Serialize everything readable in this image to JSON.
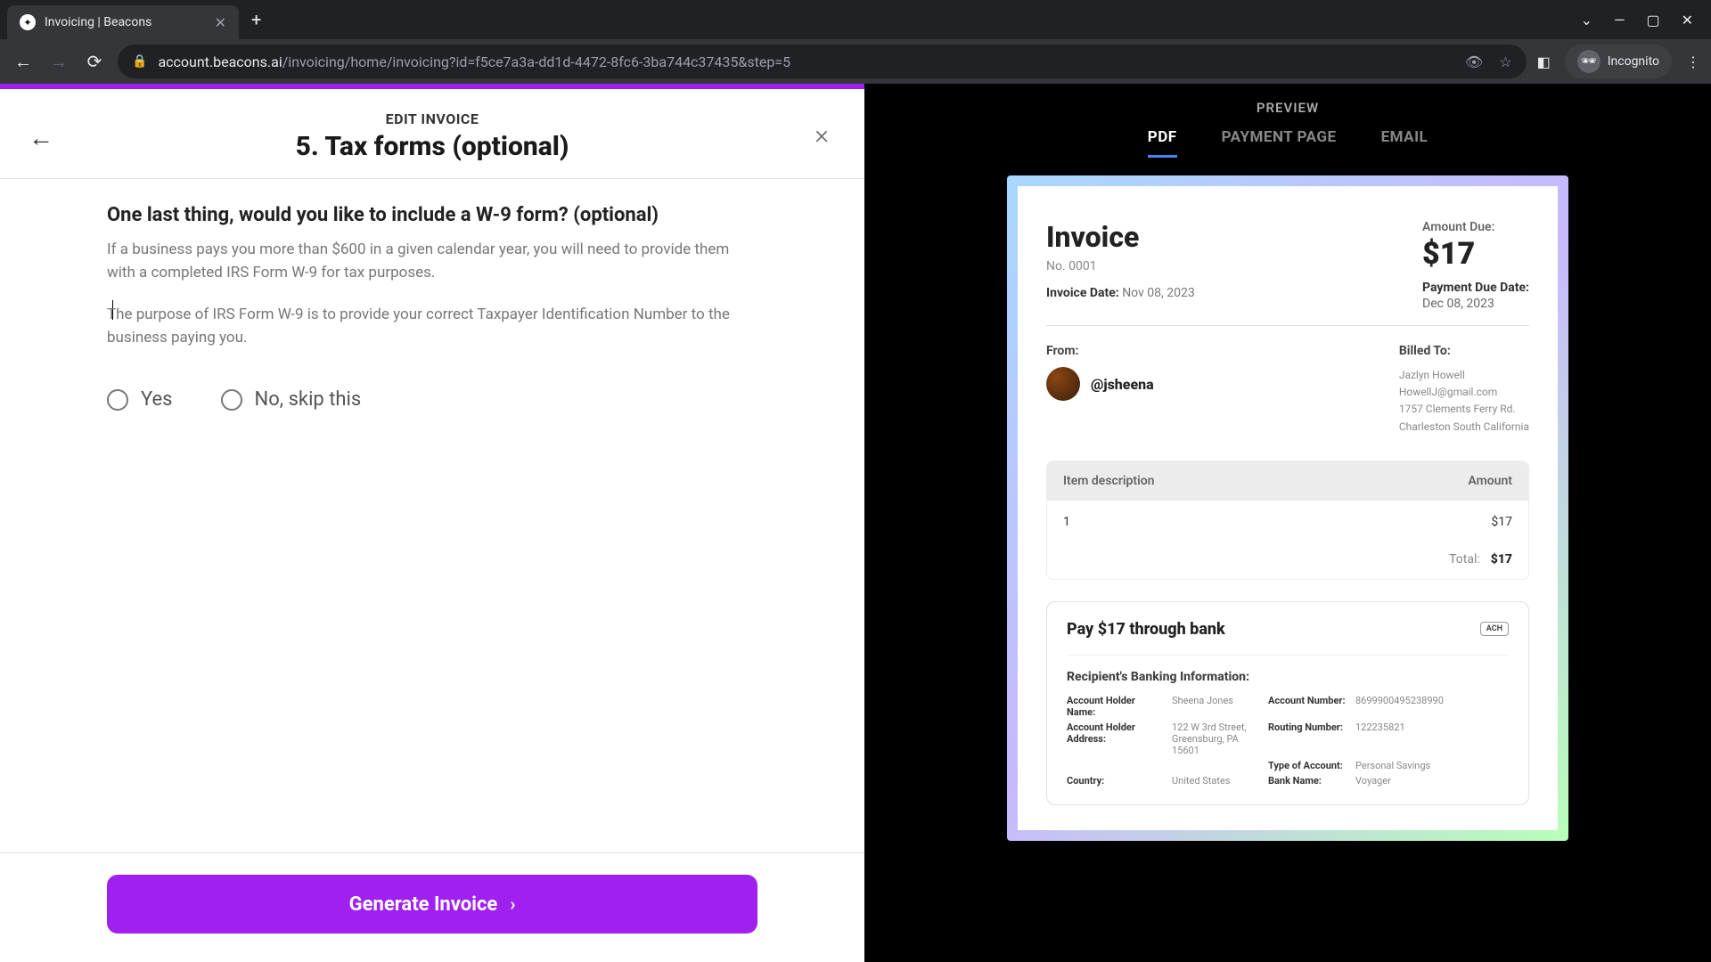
{
  "browser": {
    "tab_title": "Invoicing | Beacons",
    "url_host": "account.beacons.ai",
    "url_path": "/invoicing/home/invoicing?id=f5ce7a3a-dd1d-4472-8fc6-3ba744c37435&step=5",
    "incognito_label": "Incognito"
  },
  "editor": {
    "top_label": "EDIT INVOICE",
    "step_title": "5. Tax forms (optional)",
    "question": "One last thing, would you like to include a W-9 form? (optional)",
    "desc1": "If a business pays you more than $600 in a given calendar year, you will need to provide them with a completed IRS Form W-9 for tax purposes.",
    "desc2": "The purpose of IRS Form W-9 is to provide your correct Taxpayer Identification Number to the business paying you.",
    "radio_yes": "Yes",
    "radio_no": "No, skip this",
    "generate_label": "Generate Invoice"
  },
  "preview": {
    "label": "PREVIEW",
    "tabs": {
      "pdf": "PDF",
      "payment": "PAYMENT PAGE",
      "email": "EMAIL"
    },
    "active_tab": "pdf"
  },
  "invoice": {
    "title": "Invoice",
    "number": "No. 0001",
    "invoice_date_label": "Invoice Date:",
    "invoice_date": "Nov 08, 2023",
    "amount_due_label": "Amount Due:",
    "amount_due": "$17",
    "payment_due_label": "Payment Due Date:",
    "payment_due": "Dec 08, 2023",
    "from_label": "From:",
    "from_handle": "@jsheena",
    "billed_to_label": "Billed To:",
    "billed_to": {
      "name": "Jazlyn Howell",
      "email": "HowellJ@gmail.com",
      "addr1": "1757 Clements Ferry Rd.",
      "addr2": "Charleston South California"
    },
    "items_header_desc": "Item description",
    "items_header_amt": "Amount",
    "items": [
      {
        "desc": "1",
        "amount": "$17"
      }
    ],
    "total_label": "Total:",
    "total": "$17",
    "bank": {
      "pay_title": "Pay $17 through bank",
      "ach_badge": "ACH",
      "info_title": "Recipient's Banking Information:",
      "fields": {
        "holder_name_label": "Account Holder Name:",
        "holder_name": "Sheena Jones",
        "holder_addr_label": "Account Holder Address:",
        "holder_addr1": "122 W 3rd Street,",
        "holder_addr2": "Greensburg, PA 15601",
        "country_label": "Country:",
        "country": "United States",
        "acct_num_label": "Account Number:",
        "acct_num": "8699900495238990",
        "routing_label": "Routing Number:",
        "routing": "122235821",
        "acct_type_label": "Type of Account:",
        "acct_type": "Personal Savings",
        "bank_name_label": "Bank Name:",
        "bank_name": "Voyager"
      }
    }
  }
}
